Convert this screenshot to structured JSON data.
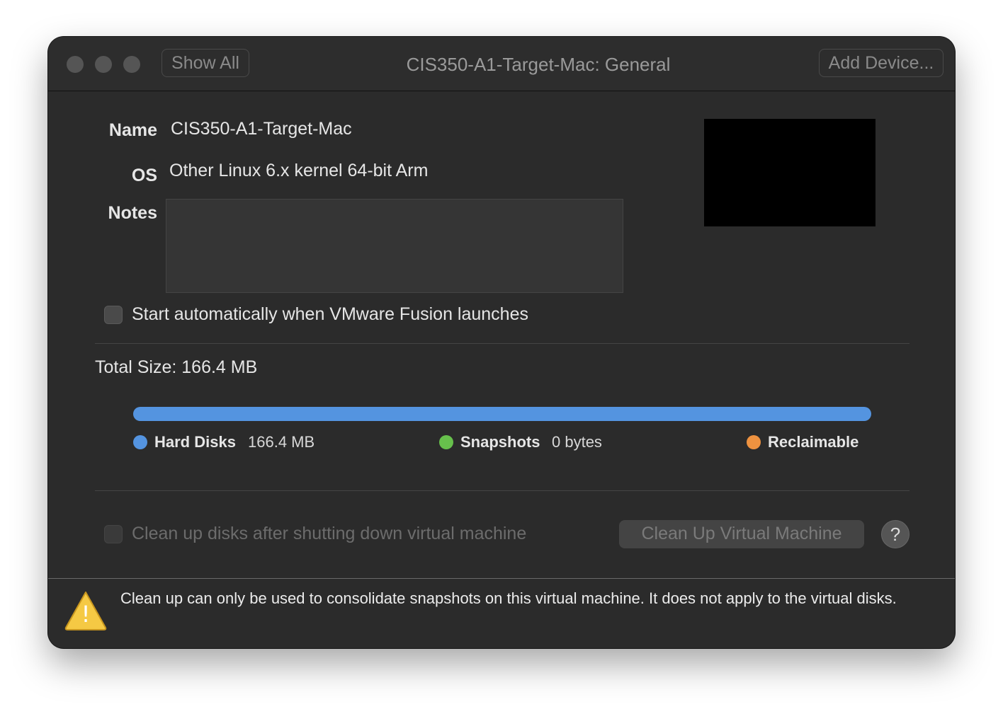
{
  "window": {
    "title": "CIS350-A1-Target-Mac: General",
    "show_all_label": "Show All",
    "add_device_label": "Add Device..."
  },
  "general": {
    "name_label": "Name",
    "name_value": "CIS350-A1-Target-Mac",
    "os_label": "OS",
    "os_value": "Other Linux 6.x kernel 64-bit Arm",
    "notes_label": "Notes",
    "notes_value": "",
    "autostart_label": "Start automatically when VMware Fusion launches",
    "autostart_checked": false
  },
  "storage": {
    "total_size": "Total Size: 166.4 MB",
    "legend": [
      {
        "name": "Hard Disks",
        "value": "166.4 MB",
        "color": "#5494e0"
      },
      {
        "name": "Snapshots",
        "value": "0 bytes",
        "color": "#67c04c"
      },
      {
        "name": "Reclaimable",
        "value": "",
        "color": "#ee9240"
      }
    ],
    "hard_disks_fraction": 1.0
  },
  "cleanup": {
    "checkbox_label": "Clean up disks after shutting down virtual machine",
    "button_label": "Clean Up Virtual Machine",
    "help_label": "?"
  },
  "footer": {
    "warning_text": "Clean up can only be used to consolidate snapshots on this virtual machine. It does not apply to the virtual disks.",
    "warning_icon_glyph": "!"
  }
}
